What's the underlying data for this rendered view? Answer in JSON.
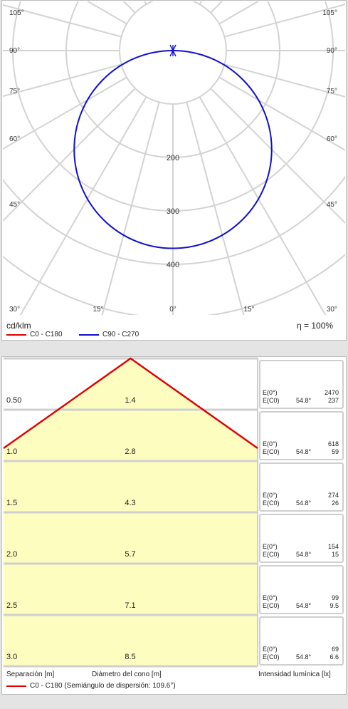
{
  "chart_data": [
    {
      "type": "polar",
      "unit_label": "cd/klm",
      "efficiency_label": "η = 100%",
      "angle_labels_left": [
        "105°",
        "90°",
        "75°",
        "60°",
        "45°",
        "30°"
      ],
      "angle_labels_right": [
        "105°",
        "90°",
        "75°",
        "60°",
        "45°",
        "30°"
      ],
      "bottom_angle_labels": [
        "15°",
        "0°",
        "15°"
      ],
      "radial_ticks": [
        200,
        300,
        400
      ],
      "rmax": 400,
      "series": [
        {
          "name": "C0 - C180",
          "color": "#e00000",
          "visible_curve": false
        },
        {
          "name": "C90 - C270",
          "color": "#1010d0",
          "visible_curve": true,
          "shape": "circle_through_origin",
          "intensity_at_0deg": 370
        }
      ]
    },
    {
      "type": "table",
      "columns": [
        "Separación [m]",
        "Diámetro del cono [m]",
        "Intensidad lumínica [lx]"
      ],
      "rows": [
        {
          "separation": "0.50",
          "diameter": "1.4",
          "e0_label": "E(0°)",
          "e0": "2470",
          "ec0_label": "E(C0)",
          "angle": "54.8°",
          "ec0": "237"
        },
        {
          "separation": "1.0",
          "diameter": "2.8",
          "e0_label": "E(0°)",
          "e0": "618",
          "ec0_label": "E(C0)",
          "angle": "54.8°",
          "ec0": "59"
        },
        {
          "separation": "1.5",
          "diameter": "4.3",
          "e0_label": "E(0°)",
          "e0": "274",
          "ec0_label": "E(C0)",
          "angle": "54.8°",
          "ec0": "26"
        },
        {
          "separation": "2.0",
          "diameter": "5.7",
          "e0_label": "E(0°)",
          "e0": "154",
          "ec0_label": "E(C0)",
          "angle": "54.8°",
          "ec0": "15"
        },
        {
          "separation": "2.5",
          "diameter": "7.1",
          "e0_label": "E(0°)",
          "e0": "99",
          "ec0_label": "E(C0)",
          "angle": "54.8°",
          "ec0": "9.5"
        },
        {
          "separation": "3.0",
          "diameter": "8.5",
          "e0_label": "E(0°)",
          "e0": "69",
          "ec0_label": "E(C0)",
          "angle": "54.8°",
          "ec0": "6.6"
        }
      ],
      "legend": {
        "name": "C0 - C180 (Semiángulo de dispersión: 109.6°)",
        "color": "#e00000"
      },
      "half_spread_angle_deg": 109.6,
      "fill_color": "#fdfdc0"
    }
  ]
}
